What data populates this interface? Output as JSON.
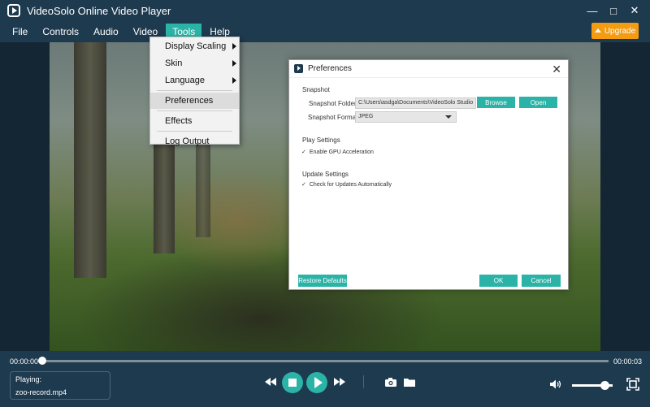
{
  "app": {
    "title": "VideoSolo Online Video Player"
  },
  "window_controls": {
    "minimize": "—",
    "maximize": "□",
    "close": "✕"
  },
  "menubar": {
    "items": [
      "File",
      "Controls",
      "Audio",
      "Video",
      "Tools",
      "Help"
    ],
    "active": "Tools",
    "upgrade_label": "Upgrade"
  },
  "tools_menu": {
    "items": [
      {
        "label": "Display Scaling",
        "submenu": true
      },
      {
        "label": "Skin",
        "submenu": true
      },
      {
        "label": "Language",
        "submenu": true
      },
      {
        "label": "Preferences",
        "submenu": false
      },
      {
        "label": "Effects",
        "submenu": false
      },
      {
        "label": "Log Output",
        "submenu": false
      }
    ]
  },
  "preferences": {
    "title": "Preferences",
    "snapshot_section": "Snapshot",
    "snapshot_folder_label": "Snapshot Folder:",
    "snapshot_folder_value": "C:\\Users\\asdga\\Documents\\VideoSolo Studio",
    "browse_label": "Browse",
    "open_label": "Open",
    "snapshot_format_label": "Snapshot Format:",
    "snapshot_format_value": "JPEG",
    "play_section": "Play Settings",
    "gpu_label": "Enable GPU Acceleration",
    "gpu_checked": true,
    "update_section": "Update Settings",
    "update_label": "Check for Updates Automatically",
    "update_checked": true,
    "restore_label": "Restore Defaults",
    "ok_label": "OK",
    "cancel_label": "Cancel"
  },
  "player": {
    "current_time": "00:00:00",
    "total_time": "00:00:03",
    "progress": 0.0,
    "playing_label": "Playing:",
    "file_name": "zoo-record.mp4",
    "volume": 0.8
  },
  "colors": {
    "accent": "#2ab3a6",
    "upgrade": "#f39c12",
    "chrome": "#1e3a4f"
  }
}
